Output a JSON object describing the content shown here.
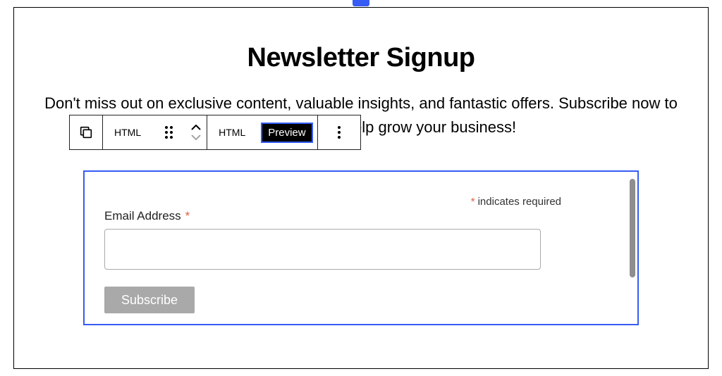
{
  "selection": {
    "topHandle": true
  },
  "page": {
    "title": "Newsletter Signup",
    "intro": "Don't miss out on exclusive content, valuable insights, and fantastic offers. Subscribe now to stay in the loop and help grow your business!"
  },
  "toolbar": {
    "blockTypeLabel1": "HTML",
    "blockTypeLabel2": "HTML",
    "previewLabel": "Preview"
  },
  "form": {
    "requiredNote": "indicates required",
    "emailLabel": "Email Address",
    "subscribeLabel": "Subscribe"
  }
}
